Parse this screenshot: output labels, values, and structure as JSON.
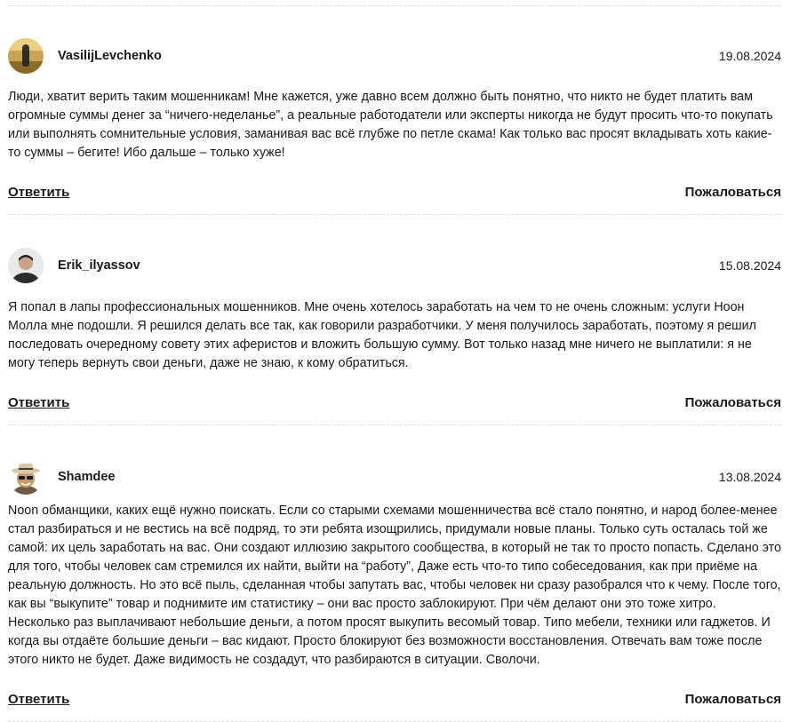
{
  "comments": [
    {
      "author": "VasilijLevchenko",
      "date": "19.08.2024",
      "avatar_icon": "user-avatar-field",
      "text": "Люди, хватит верить таким мошенникам! Мне кажется, уже давно всем должно быть понятно, что никто не будет платить вам огромные суммы денег за “ничего-неделанье”, а реальные работодатели или эксперты никогда не будут просить что-то покупать или выполнять сомнительные условия, заманивая вас всё глубже по петле скама! Как только вас просят вкладывать хоть какие-то суммы – бегите! Ибо дальше – только хуже!",
      "reply_label": "Ответить",
      "report_label": "Пожаловаться"
    },
    {
      "author": "Erik_ilyassov",
      "date": "15.08.2024",
      "avatar_icon": "user-avatar-man",
      "text": "Я попал в лапы профессиональных мошенников. Мне очень хотелось заработать на чем то не очень сложным: услуги Ноон Молла мне подошли. Я решился делать все так, как говорили разработчики. У меня получилось заработать, поэтому я решил последовать очередному совету этих аферистов и вложить большую сумму. Вот только назад мне ничего не выплатили: я не могу теперь вернуть свои деньги, даже не знаю, к кому обратиться.",
      "reply_label": "Ответить",
      "report_label": "Пожаловаться"
    },
    {
      "author": "Shamdee",
      "date": "13.08.2024",
      "avatar_icon": "user-avatar-hat-sunglasses",
      "text": "Noon обманщики, каких ещё нужно поискать. Если со старыми схемами мошенничества всё стало понятно, и народ более-менее стал разбираться и не вестись на всё подряд, то эти ребята изощрились, придумали новые планы. Только суть осталась той же самой: их цель заработать на вас. Они создают иллюзию закрытого сообщества, в который не так то просто попасть. Сделано это для того, чтобы человек сам стремился их найти, выйти на “работу”, Даже есть что-то типо собеседования, как при приёме на реальную должность. Но это всё пыль, сделанная чтобы запутать вас, чтобы человек ни сразу разобрался что к чему. После того, как вы “выкупите” товар и поднимите им статистику – они вас просто заблокируют. При чём делают они это тоже хитро. Несколько раз выплачивают небольшие деньги, а потом просят выкупить весомый товар. Типо мебели, техники или гаджетов. И когда вы отдаёте большие деньги – вас кидают. Просто блокируют без возможности восстановления. Отвечать вам тоже после этого никто не будет. Даже видимость не создадут, что разбираются в ситуации. Сволочи.",
      "reply_label": "Ответить",
      "report_label": "Пожаловаться"
    }
  ]
}
